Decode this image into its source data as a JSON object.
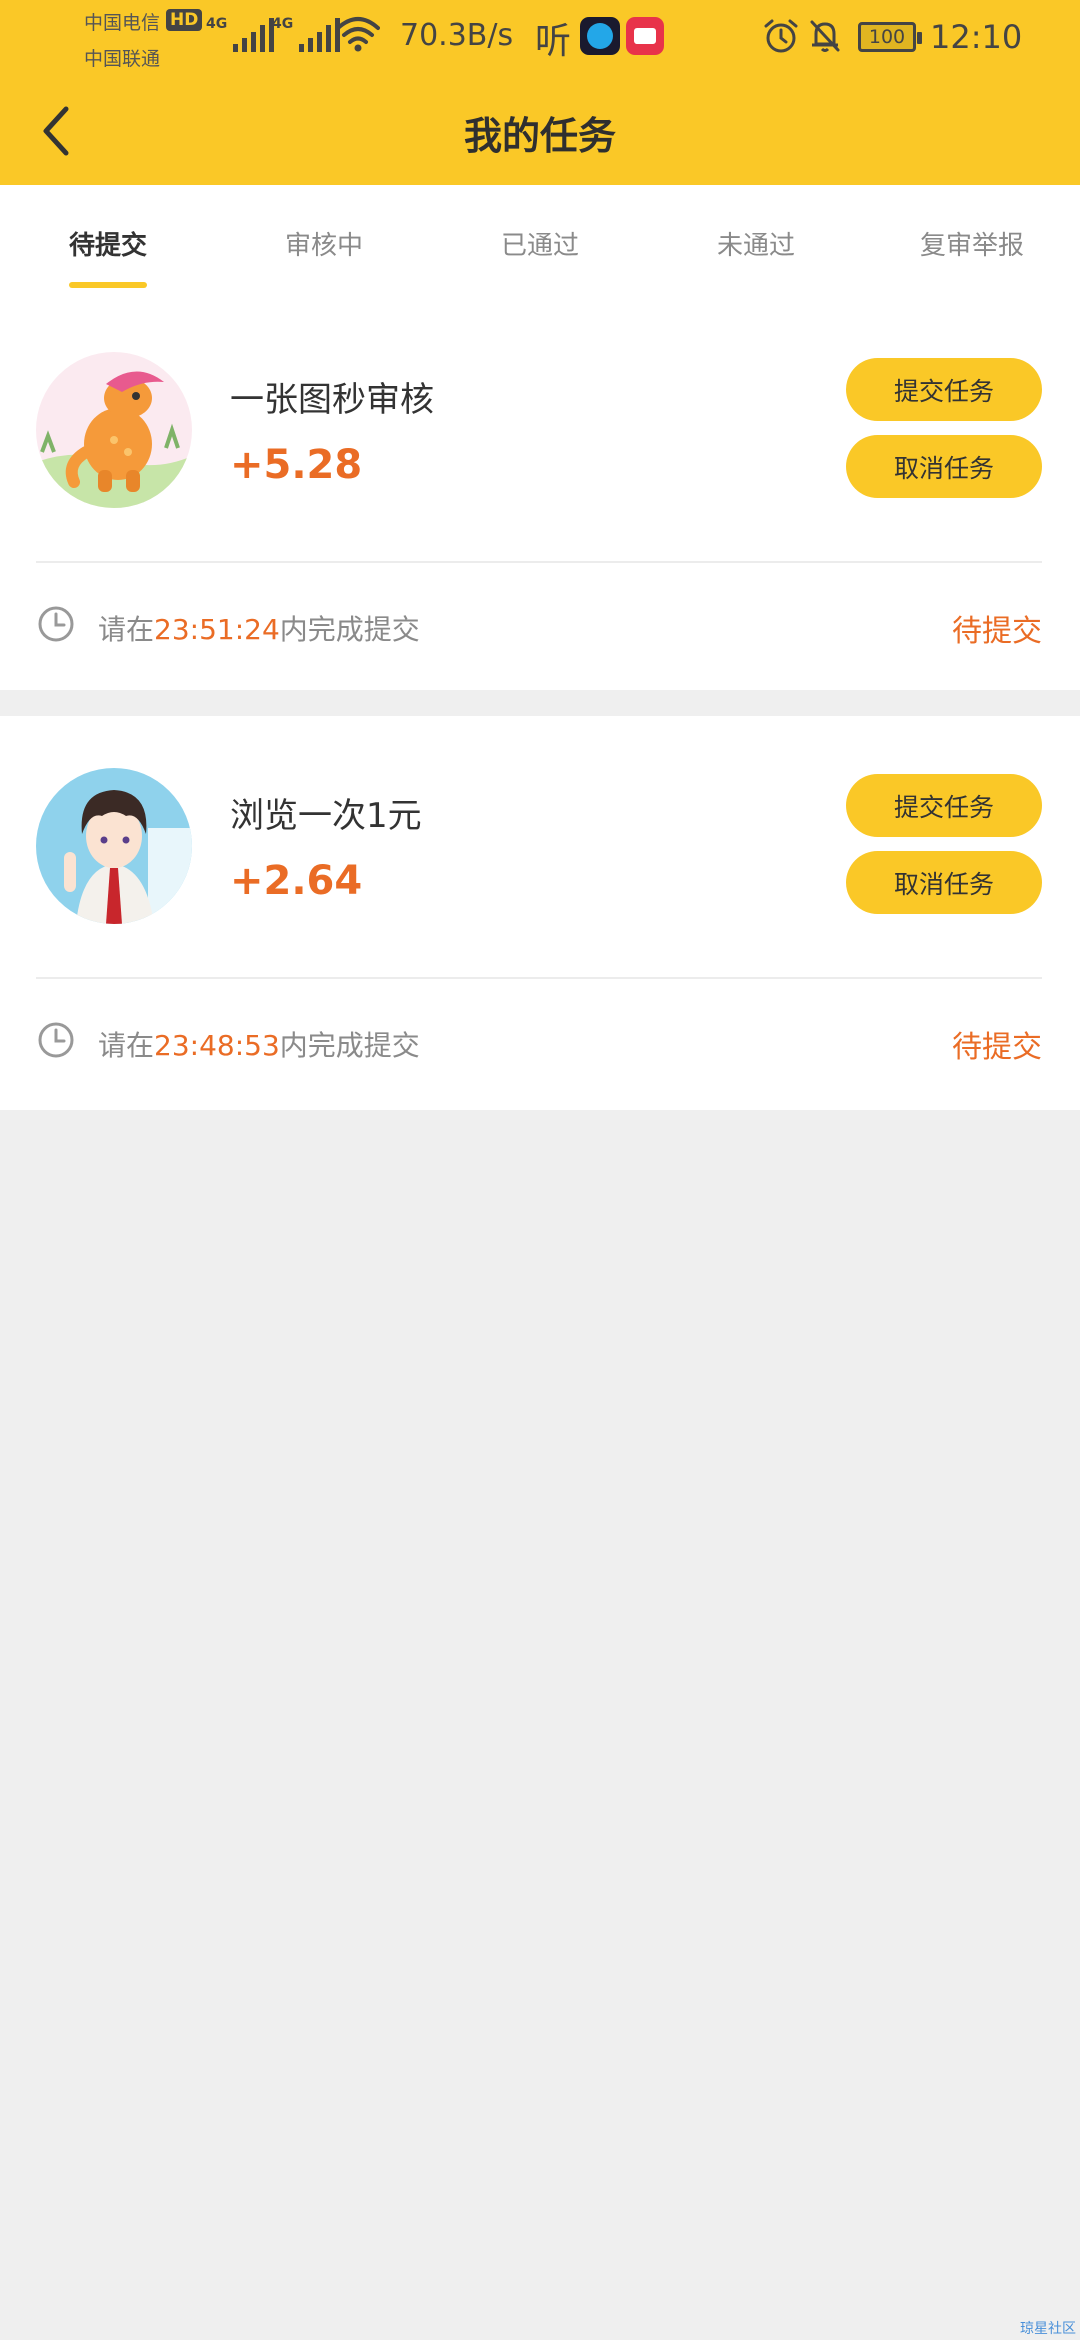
{
  "status_bar": {
    "carrier_1": "中国电信",
    "carrier_2": "中国联通",
    "hd_badge": "HD",
    "signal_label_1": "4G",
    "signal_label_2": "4G",
    "net_speed": "70.3B/s",
    "listen_label": "听",
    "battery_level": "100",
    "time": "12:10"
  },
  "header": {
    "title": "我的任务"
  },
  "tabs": [
    {
      "label": "待提交",
      "active": true
    },
    {
      "label": "审核中",
      "active": false
    },
    {
      "label": "已通过",
      "active": false
    },
    {
      "label": "未通过",
      "active": false
    },
    {
      "label": "复审举报",
      "active": false
    }
  ],
  "tasks": [
    {
      "title": "一张图秒审核",
      "reward": "+5.28",
      "submit_label": "提交任务",
      "cancel_label": "取消任务",
      "deadline_prefix": "请在",
      "deadline_time": "23:51:24",
      "deadline_suffix": "内完成提交",
      "status": "待提交"
    },
    {
      "title": "浏览一次1元",
      "reward": "+2.64",
      "submit_label": "提交任务",
      "cancel_label": "取消任务",
      "deadline_prefix": "请在",
      "deadline_time": "23:48:53",
      "deadline_suffix": "内完成提交",
      "status": "待提交"
    }
  ],
  "watermark": "琼星社区",
  "colors": {
    "brand_yellow": "#fac827",
    "accent_orange": "#ea6c25",
    "background": "#efefef"
  }
}
